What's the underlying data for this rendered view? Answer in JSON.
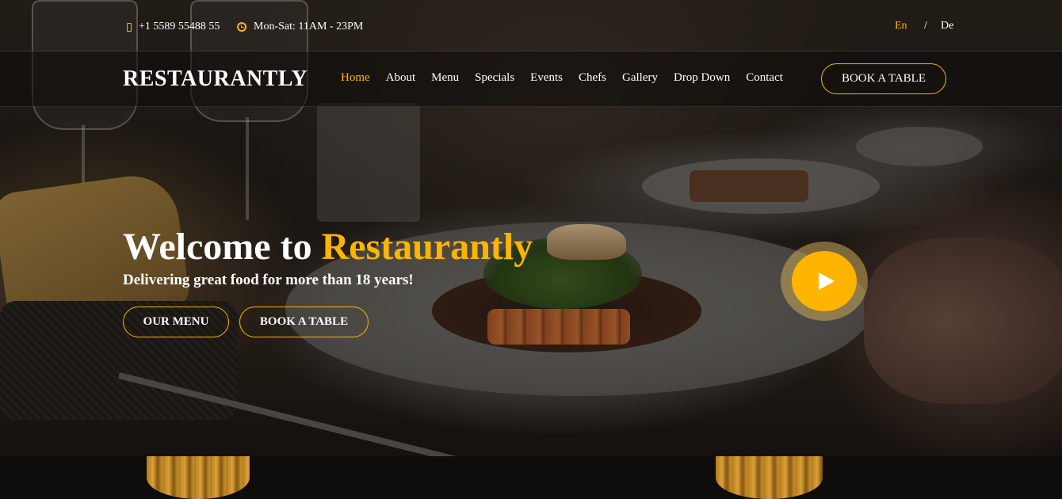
{
  "topbar": {
    "phone": "+1 5589 55488 55",
    "hours": "Mon-Sat: 11AM - 23PM",
    "lang_en": "En",
    "lang_separator": "/",
    "lang_de": "De"
  },
  "header": {
    "logo": "RESTAURANTLY",
    "nav": [
      "Home",
      "About",
      "Menu",
      "Specials",
      "Events",
      "Chefs",
      "Gallery",
      "Drop Down",
      "Contact"
    ],
    "active_nav": "Home",
    "book_button": "BOOK A TABLE"
  },
  "hero": {
    "title_prefix": "Welcome to ",
    "title_accent": "Restaurantly",
    "subtitle": "Delivering great food for more than 18 years!",
    "menu_button": "OUR MENU",
    "book_button": "BOOK A TABLE"
  },
  "icons": {
    "phone": "phone-icon",
    "hours": "clock-icon",
    "play": "play-icon"
  },
  "colors": {
    "accent": "#ffb400",
    "text": "#ffffff",
    "header_bg": "#0c0b09"
  }
}
